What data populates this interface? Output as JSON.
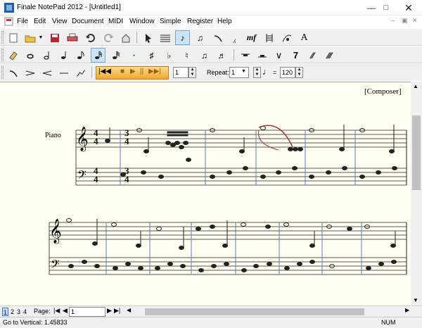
{
  "window": {
    "title": "Finale NotePad 2012 - [Untitled1]"
  },
  "menu": {
    "items": [
      "File",
      "Edit",
      "View",
      "Document",
      "MIDI",
      "Window",
      "Simple",
      "Register",
      "Help"
    ]
  },
  "toolbar1": {
    "icons": [
      "new-icon",
      "open-icon",
      "dropdown-icon",
      "save-icon",
      "print-icon",
      "undo-icon",
      "redo-icon",
      "home-icon",
      "selection-tool-icon",
      "staff-tool-icon",
      "simple-entry-icon",
      "speedy-entry-icon",
      "slur-tool-icon",
      "articulation-tool-icon",
      "expression-tool-icon",
      "measure-tool-icon",
      "chord-tool-icon",
      "text-tool-icon"
    ],
    "letters": {
      "expr": "mf",
      "text": "A"
    }
  },
  "toolbar2": {
    "glyphs": [
      "✎",
      "𝅝",
      "𝅗𝅥",
      "♩",
      "♪",
      "♪",
      "♬",
      "·",
      "♯",
      "♭",
      "♮",
      "♪♪",
      "♬♬",
      "▬",
      "▬",
      "𝄽",
      "𝄾",
      "𝄿",
      "𝅀"
    ]
  },
  "toolbar3": {
    "measure": "1",
    "repeat_label": "Repeat:",
    "repeat_value": "1",
    "tempo_eq": "=",
    "tempo": "120"
  },
  "score": {
    "composer": "[Composer]",
    "instrument": "Piano",
    "time_sig_1": [
      "4",
      "4"
    ],
    "time_sig_2": [
      "3",
      "4"
    ],
    "colors": {
      "paper": "#fffff2",
      "barline": "#5a7fb5",
      "selection": "#b03030"
    }
  },
  "status": {
    "page_label": "Page:",
    "page_value": "1",
    "page_tabs": [
      "1",
      "2",
      "3",
      "4"
    ],
    "readout": "Go to Vertical: 1.45833",
    "num": "NUM"
  }
}
